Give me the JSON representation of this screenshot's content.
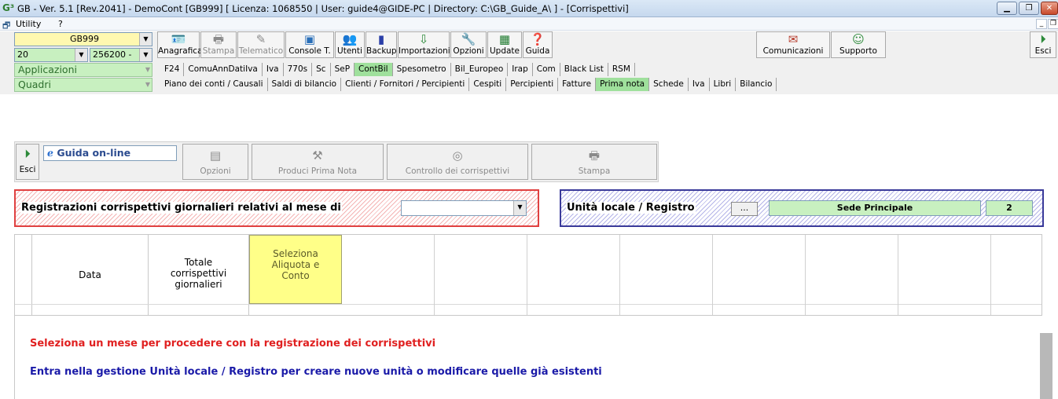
{
  "window": {
    "icon_label": "G³",
    "title": "GB - Ver. 5.1 [Rev.2041] -  DemoCont [GB999]    [ Licenza: 1068550 | User: guide4@GIDE-PC | Directory: C:\\GB_Guide_A\\ ] - [Corrispettivi]",
    "controls": [
      "minimize-icon",
      "restore-icon",
      "close-icon"
    ]
  },
  "menubar": {
    "items": [
      "Utility",
      "?"
    ]
  },
  "toolbar": {
    "company_combo": "GB999",
    "year_combo": "20",
    "code_combo": "256200 -",
    "buttons": [
      {
        "label": "Anagrafica",
        "icon": "id-card-icon",
        "enabled": true
      },
      {
        "label": "Stampa",
        "icon": "printer-icon",
        "enabled": false
      },
      {
        "label": "Telematico",
        "icon": "telematic-icon",
        "enabled": false
      },
      {
        "label": "Console T.",
        "icon": "console-icon",
        "enabled": true
      },
      {
        "label": "Utenti",
        "icon": "users-icon",
        "enabled": true
      },
      {
        "label": "Backup",
        "icon": "backup-icon",
        "enabled": true
      },
      {
        "label": "Importazioni",
        "icon": "import-icon",
        "enabled": true
      },
      {
        "label": "Opzioni",
        "icon": "wrench-icon",
        "enabled": true
      },
      {
        "label": "Update",
        "icon": "update-icon",
        "enabled": true
      },
      {
        "label": "Guida",
        "icon": "help-icon",
        "enabled": true
      }
    ],
    "comunicazioni": "Comunicazioni",
    "supporto": "Supporto",
    "esci": "Esci"
  },
  "applicazioni": {
    "label": "Applicazioni",
    "tabs": [
      "F24",
      "ComuAnnDatiIva",
      "Iva",
      "770s",
      "Sc",
      "SeP",
      "ContBil",
      "Spesometro",
      "Bil_Europeo",
      "Irap",
      "Com",
      "Black List",
      "RSM"
    ],
    "active": "ContBil"
  },
  "quadri": {
    "label": "Quadri",
    "tabs": [
      "Piano dei conti / Causali",
      "Saldi di bilancio",
      "Clienti / Fornitori / Percipienti",
      "Cespiti",
      "Percipienti",
      "Fatture",
      "Prima nota",
      "Schede",
      "Iva",
      "Libri",
      "Bilancio"
    ],
    "active": "Prima nota"
  },
  "page_toolbar": {
    "esci": "Esci",
    "guida": "Guida on-line",
    "opzioni": "Opzioni",
    "produci": "Produci  Prima Nota",
    "controllo": "Controllo dei corrispettivi",
    "stampa": "Stampa"
  },
  "registrazioni": {
    "label": "Registrazioni corrispettivi giornalieri relativi al mese di",
    "month_value": ""
  },
  "unita": {
    "label": "Unità locale / Registro",
    "browse": "...",
    "sede": "Sede Principale",
    "number": "2"
  },
  "grid": {
    "headers": [
      "Data",
      "Totale corrispettivi giornalieri",
      "Seleziona Aliquota e Conto"
    ]
  },
  "messages": {
    "line1": "Seleziona un mese per procedere con la registrazione dei corrispettivi",
    "line2": "Entra nella gestione Unità locale / Registro per creare nuove unità o modificare quelle già esistenti"
  },
  "colors": {
    "green_tab": "#9fe09c",
    "red_text": "#e02020",
    "blue_text": "#1a1aa8"
  }
}
